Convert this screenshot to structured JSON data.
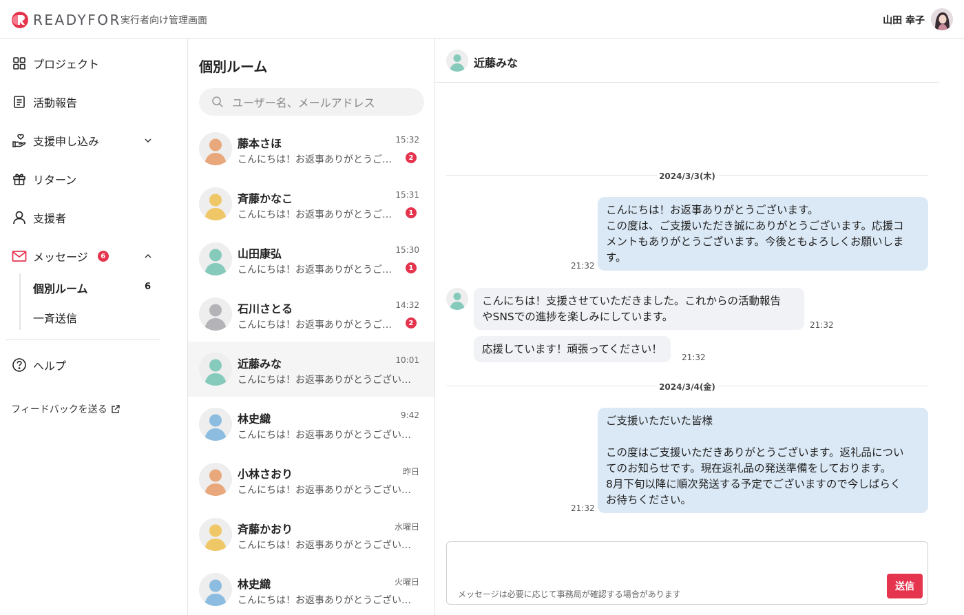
{
  "header": {
    "brand": "READYFOR",
    "subtitle": "実行者向け管理画面",
    "user_name": "山田 幸子"
  },
  "nav": {
    "items": [
      {
        "label": "プロジェクト",
        "icon": "grid-icon"
      },
      {
        "label": "活動報告",
        "icon": "document-icon"
      },
      {
        "label": "支援申し込み",
        "icon": "hand-heart-icon"
      },
      {
        "label": "リターン",
        "icon": "gift-icon"
      },
      {
        "label": "支援者",
        "icon": "person-icon"
      },
      {
        "label": "メッセージ",
        "icon": "mail-icon",
        "badge": "6"
      }
    ],
    "sub_items": [
      {
        "label": "個別ルーム",
        "count": "6"
      },
      {
        "label": "一斉送信"
      }
    ],
    "help_label": "ヘルプ",
    "feedback_label": "フィードバックを送る",
    "accent_color": "#e5344e"
  },
  "rooms": {
    "title": "個別ルーム",
    "search_placeholder": "ユーザー名、メールアドレス",
    "list": [
      {
        "name": "藤本さほ",
        "time": "15:32",
        "preview": "こんにちは！お返事ありがとうございます。",
        "unread": "2",
        "color": "#e8a87c"
      },
      {
        "name": "斉藤かなこ",
        "time": "15:31",
        "preview": "こんにちは！お返事ありがとうございます。",
        "unread": "1",
        "color": "#f0c766"
      },
      {
        "name": "山田康弘",
        "time": "15:30",
        "preview": "こんにちは！お返事ありがとうございます。",
        "unread": "1",
        "color": "#86cabb"
      },
      {
        "name": "石川さとる",
        "time": "14:32",
        "preview": "こんにちは！お返事ありがとうございます。",
        "unread": "2",
        "color": "#b4b4b8"
      },
      {
        "name": "近藤みな",
        "time": "10:01",
        "preview": "こんにちは！お返事ありがとうございます。",
        "unread": "",
        "color": "#86cabb"
      },
      {
        "name": "林史織",
        "time": "9:42",
        "preview": "こんにちは！お返事ありがとうございます。",
        "unread": "",
        "color": "#8cbce0"
      },
      {
        "name": "小林さおり",
        "time": "昨日",
        "preview": "こんにちは！お返事ありがとうございます。",
        "unread": "",
        "color": "#e8a87c"
      },
      {
        "name": "斉藤かおり",
        "time": "水曜日",
        "preview": "こんにちは！お返事ありがとうございます。",
        "unread": "",
        "color": "#f0c766"
      },
      {
        "name": "林史織",
        "time": "火曜日",
        "preview": "こんにちは！お返事ありがとうございます。",
        "unread": "",
        "color": "#8cbce0"
      }
    ]
  },
  "chat": {
    "partner_name": "近藤みな",
    "partner_color": "#86cabb",
    "date1": "2024/3/3(木)",
    "msg1": {
      "lines": [
        "こんにちは！お返事ありがとうございます。",
        "この度は、ご支援いただき誠にありがとうございます。応援コ",
        "メントもありがとうございます。今後ともよろしくお願いしま",
        "す。"
      ],
      "time": "21:32"
    },
    "msg2": {
      "lines": [
        "こんにちは！支援させていただきました。これからの活動報告",
        "やSNSでの進捗を楽しみにしています。"
      ],
      "time": "21:32"
    },
    "msg3": {
      "lines": [
        "応援しています！頑張ってください！"
      ],
      "time": "21:32"
    },
    "date2": "2024/3/4(金)",
    "msg4": {
      "lines": [
        "ご支援いただいた皆様",
        "",
        "この度はご支援いただきありがとうございます。返礼品につい",
        "てのお知らせです。現在返礼品の発送準備をしております。",
        "8月下旬以降に順次発送する予定でございますので今しばらく",
        "お待ちください。"
      ],
      "time": "21:32"
    },
    "composer_note": "メッセージは必要に応じて事務局が確認する場合があります",
    "send_label": "送信"
  }
}
